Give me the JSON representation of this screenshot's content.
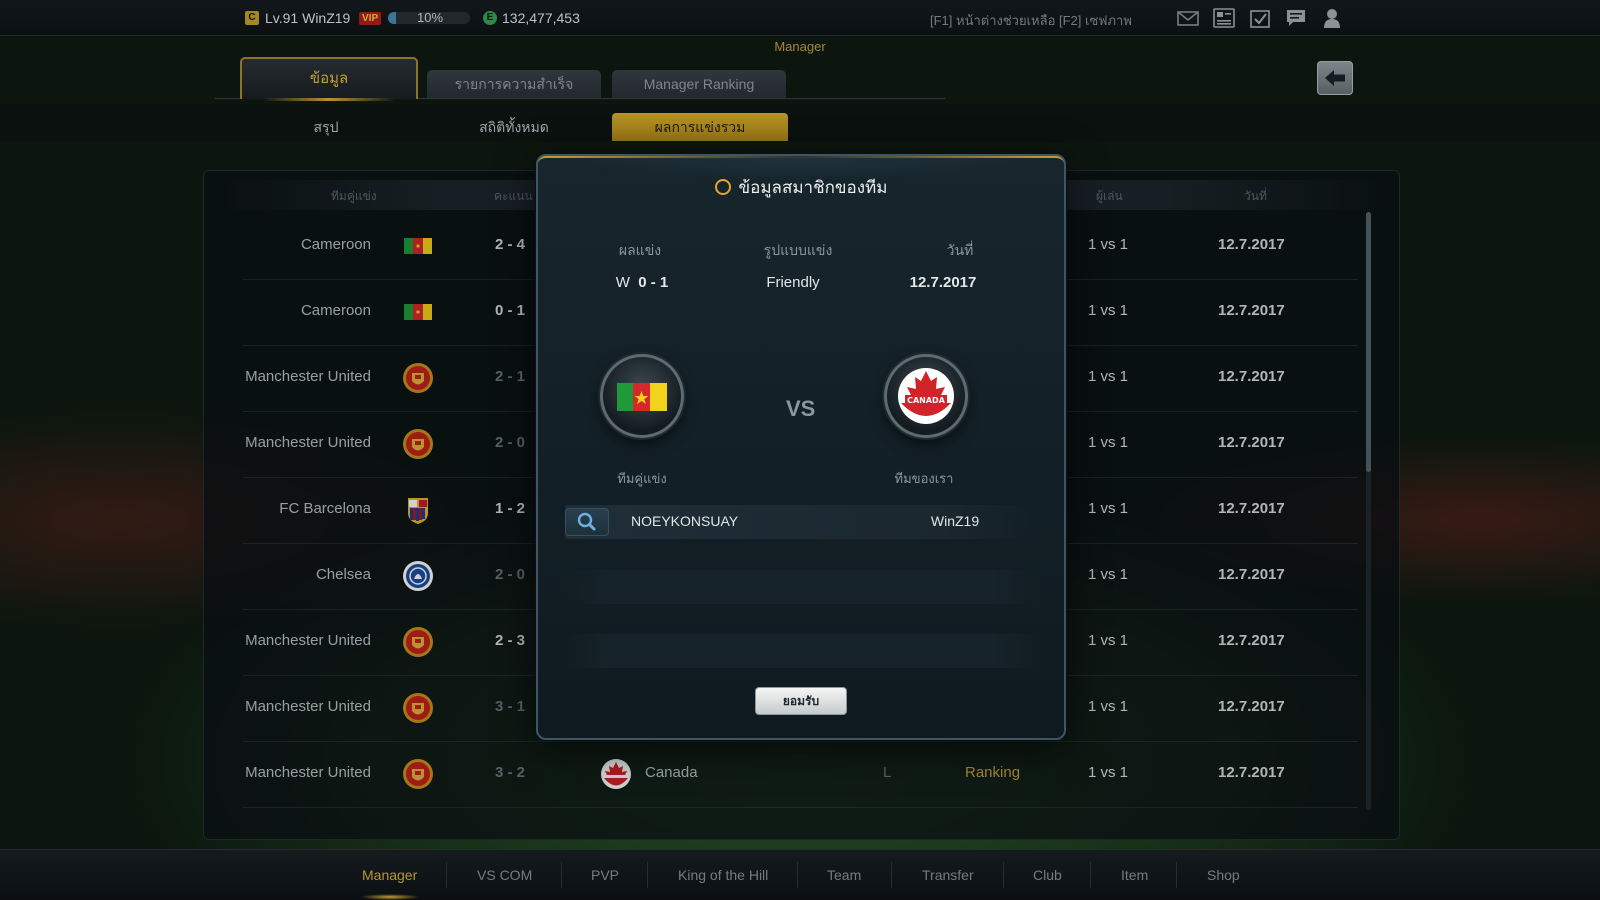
{
  "topbar": {
    "level_badge": "C",
    "level_text": "Lv.91 WinZ19",
    "vip_label": "VIP",
    "exp_percent": 10,
    "exp_text": "10%",
    "coin_badge": "E",
    "coins": "132,477,453",
    "help_text": "[F1] หน้าต่างช่วยเหลือ [F2] เซฟภาพ",
    "icons": [
      "mail-icon",
      "profile-card-icon",
      "checklist-icon",
      "chat-icon",
      "user-icon"
    ]
  },
  "screen_title": "Manager",
  "tabs": [
    {
      "label": "ข้อมูล",
      "active": true
    },
    {
      "label": "รายการความสำเร็จ",
      "active": false
    },
    {
      "label": "Manager Ranking",
      "active": false
    }
  ],
  "subtabs": [
    {
      "label": "สรุป",
      "active": false
    },
    {
      "label": "สถิติทั้งหมด",
      "active": false
    },
    {
      "label": "ผลการแข่งรวม",
      "active": true
    }
  ],
  "table": {
    "headers": {
      "opponent": "ทีมคู่แข่ง",
      "score": "คะแนน",
      "players": "ผู้เล่น",
      "date": "วันที่"
    },
    "rows": [
      {
        "team": "Cameroon",
        "crest": "cameroon-flag-icon",
        "score": "2 - 4",
        "dim": false,
        "players": "1 vs 1",
        "date": "12.7.2017"
      },
      {
        "team": "Cameroon",
        "crest": "cameroon-flag-icon",
        "score": "0 - 1",
        "dim": false,
        "players": "1 vs 1",
        "date": "12.7.2017"
      },
      {
        "team": "Manchester United",
        "crest": "manchester-united-crest-icon",
        "score": "2 - 1",
        "dim": true,
        "players": "1 vs 1",
        "date": "12.7.2017"
      },
      {
        "team": "Manchester United",
        "crest": "manchester-united-crest-icon",
        "score": "2 - 0",
        "dim": true,
        "players": "1 vs 1",
        "date": "12.7.2017"
      },
      {
        "team": "FC Barcelona",
        "crest": "barcelona-crest-icon",
        "score": "1 - 2",
        "dim": false,
        "players": "1 vs 1",
        "date": "12.7.2017"
      },
      {
        "team": "Chelsea",
        "crest": "chelsea-crest-icon",
        "score": "2 - 0",
        "dim": true,
        "players": "1 vs 1",
        "date": "12.7.2017"
      },
      {
        "team": "Manchester United",
        "crest": "manchester-united-crest-icon",
        "score": "2 - 3",
        "dim": false,
        "players": "1 vs 1",
        "date": "12.7.2017"
      },
      {
        "team": "Manchester United",
        "crest": "manchester-united-crest-icon",
        "score": "3 - 1",
        "dim": true,
        "players": "1 vs 1",
        "date": "12.7.2017"
      },
      {
        "team": "Manchester United",
        "crest": "manchester-united-crest-icon",
        "score": "3 - 2",
        "dim": true,
        "opponent_team": "Canada",
        "opponent_crest": "canada-crest-icon",
        "result": "L",
        "mode": "Ranking",
        "players": "1 vs 1",
        "date": "12.7.2017"
      }
    ]
  },
  "modal": {
    "title": "ข้อมูลสมาชิกของทีม",
    "result_header": "ผลแข่ง",
    "mode_header": "รูปแบบแข่ง",
    "date_header": "วันที่",
    "result_prefix": "W",
    "result_score": "0 - 1",
    "mode": "Friendly",
    "date": "12.7.2017",
    "vs": "VS",
    "opponent_label": "ทีมคู่แข่ง",
    "our_label": "ทีมของเรา",
    "opponent_player": "NOEYKONSUAY",
    "our_player": "WinZ19",
    "accept_label": "ยอมรับ"
  },
  "bottom_nav": [
    {
      "label": "Manager",
      "active": true
    },
    {
      "label": "VS COM",
      "active": false
    },
    {
      "label": "PVP",
      "active": false
    },
    {
      "label": "King of the Hill",
      "active": false
    },
    {
      "label": "Team",
      "active": false
    },
    {
      "label": "Transfer",
      "active": false
    },
    {
      "label": "Club",
      "active": false
    },
    {
      "label": "Item",
      "active": false
    },
    {
      "label": "Shop",
      "active": false
    }
  ],
  "colors": {
    "accent_gold": "#e0b63c",
    "vip_red": "#b61f1f",
    "ranking_gold": "#d1a63a"
  }
}
